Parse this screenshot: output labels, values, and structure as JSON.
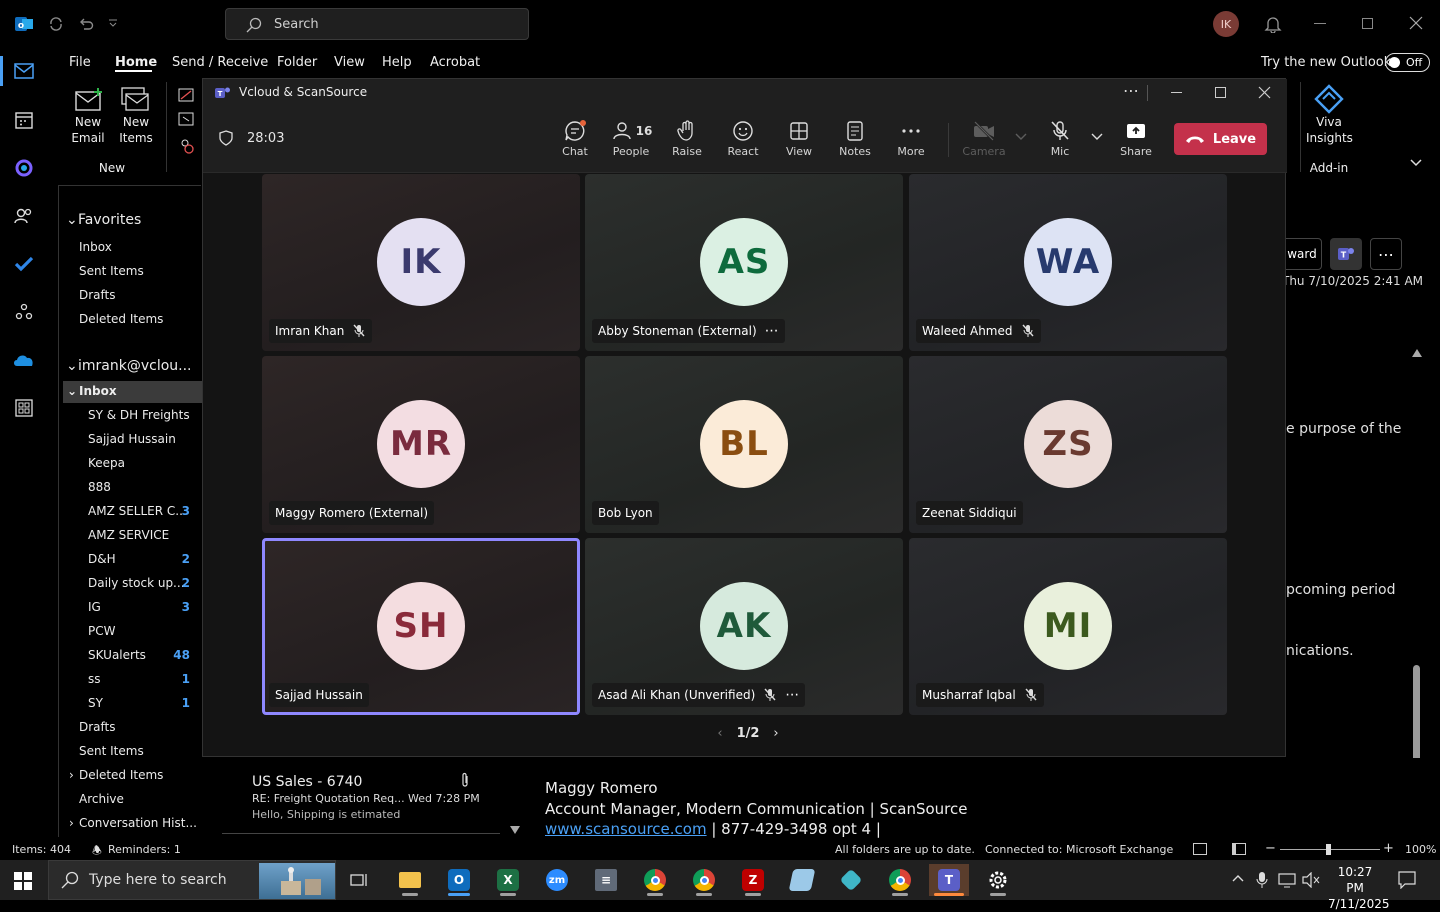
{
  "titlebar": {
    "search_placeholder": "Search",
    "avatar_initials": "IK"
  },
  "menu": {
    "file": "File",
    "home": "Home",
    "send_receive": "Send / Receive",
    "folder": "Folder",
    "view": "View",
    "help": "Help",
    "acrobat": "Acrobat",
    "try_new": "Try the new Outlook",
    "toggle": "Off"
  },
  "ribbon": {
    "new_email": [
      "New",
      "Email"
    ],
    "new_items": [
      "New",
      "Items"
    ],
    "group_new": "New",
    "viva": [
      "Viva",
      "Insights"
    ],
    "group_addin": "Add-in"
  },
  "folders": {
    "favorites": "Favorites",
    "fav_items": [
      "Inbox",
      "Sent Items",
      "Drafts",
      "Deleted Items"
    ],
    "account": "imrank@vclou...",
    "inbox": "Inbox",
    "sub": [
      {
        "name": "SY & DH Freights",
        "count": ""
      },
      {
        "name": "Sajjad Hussain",
        "count": ""
      },
      {
        "name": "Keepa",
        "count": ""
      },
      {
        "name": "888",
        "count": ""
      },
      {
        "name": "AMZ SELLER C...",
        "count": "3"
      },
      {
        "name": "AMZ SERVICE",
        "count": ""
      },
      {
        "name": "D&H",
        "count": "2"
      },
      {
        "name": "Daily stock up...",
        "count": "2"
      },
      {
        "name": "IG",
        "count": "3"
      },
      {
        "name": "PCW",
        "count": ""
      },
      {
        "name": "SKUalerts",
        "count": "48"
      },
      {
        "name": "ss",
        "count": "1"
      },
      {
        "name": "SY",
        "count": "1"
      }
    ],
    "after": [
      "Drafts",
      "Sent Items",
      "Deleted Items",
      "Archive",
      "Conversation Hist..."
    ]
  },
  "reading": {
    "forward": "ward",
    "date": "Thu 7/10/2025 2:41 AM",
    "fragments": [
      "e purpose of the",
      "pcoming period",
      "nications."
    ],
    "signature_name": "Maggy Romero",
    "signature_title": "Account Manager, Modern Communication | ScanSource",
    "signature_link": "www.scansource.com",
    "signature_phone": " | 877-429-3498 opt 4 |"
  },
  "mail_item": {
    "sender": "US Sales - 6740",
    "subject": "RE: Freight Quotation Req...",
    "date": "Wed 7:28 PM",
    "preview": "Hello, Shipping is etimated"
  },
  "status": {
    "items": "Items: 404",
    "reminders": "Reminders: 1",
    "sync": "All folders are up to date.",
    "connection": "Connected to: Microsoft Exchange",
    "zoom": "100%"
  },
  "teams": {
    "title": "Vcloud & ScanSource",
    "timer": "28:03",
    "tools": {
      "chat": "Chat",
      "people": "People",
      "people_count": "16",
      "raise": "Raise",
      "react": "React",
      "view": "View",
      "notes": "Notes",
      "more": "More",
      "camera": "Camera",
      "mic": "Mic",
      "share": "Share",
      "leave": "Leave"
    },
    "participants": [
      {
        "initials": "IK",
        "name": "Imran Khan",
        "muted": true,
        "more": false,
        "bg": "#e4e0f2",
        "fg": "#3b3a6e",
        "selected": false
      },
      {
        "initials": "AS",
        "name": "Abby Stoneman (External)",
        "muted": false,
        "more": true,
        "bg": "#dbf0e3",
        "fg": "#0e6b3d",
        "selected": false
      },
      {
        "initials": "WA",
        "name": "Waleed Ahmed",
        "muted": true,
        "more": false,
        "bg": "#dde3f4",
        "fg": "#273a6e",
        "selected": false
      },
      {
        "initials": "MR",
        "name": "Maggy Romero (External)",
        "muted": false,
        "more": false,
        "bg": "#f3dde2",
        "fg": "#7a2b3e",
        "selected": false
      },
      {
        "initials": "BL",
        "name": "Bob Lyon",
        "muted": false,
        "more": false,
        "bg": "#fbebd8",
        "fg": "#8a4d10",
        "selected": false
      },
      {
        "initials": "ZS",
        "name": "Zeenat Siddiqui",
        "muted": false,
        "more": false,
        "bg": "#ecdcd8",
        "fg": "#6a3a30",
        "selected": false
      },
      {
        "initials": "SH",
        "name": "Sajjad Hussain",
        "muted": false,
        "more": false,
        "bg": "#f4dde0",
        "fg": "#8a2a3a",
        "selected": true
      },
      {
        "initials": "AK",
        "name": "Asad Ali Khan (Unverified)",
        "muted": true,
        "more": true,
        "bg": "#d6eadd",
        "fg": "#1f5a3a",
        "selected": false
      },
      {
        "initials": "MI",
        "name": "Musharraf Iqbal",
        "muted": true,
        "more": false,
        "bg": "#e9f0dc",
        "fg": "#3c5a1e",
        "selected": false
      }
    ],
    "pager": "1/2"
  },
  "taskbar": {
    "search_placeholder": "Type here to search",
    "time": "10:27 PM",
    "date": "7/11/2025"
  }
}
